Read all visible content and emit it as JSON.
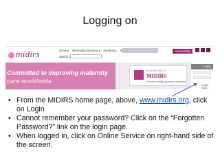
{
  "slide": {
    "title": "Logging on"
  },
  "website": {
    "logo": "midirs",
    "nav_items": [
      "Home ▸",
      "Information Services ▸",
      "Students ▸",
      "Shop",
      "Informed Choice ▸"
    ],
    "search_label": "Search the site:",
    "accessibility": "Accessibility",
    "banner_line1": "Committed to improving maternity",
    "banner_line2": "care worldwide",
    "essentially_label": "ESSENTIALLY",
    "essentially_name": "MIDIRS",
    "essentially_sub": "The new monthly journal for midwives",
    "login_header": "Login",
    "login_link": "Login, sign..."
  },
  "bullets": [
    {
      "pre": "From the MIDIRS home page, above, ",
      "link": "www.midirs.org",
      "post": ", click on Login"
    },
    {
      "pre": "Cannot remember your password? Click on the “Forgotten Password?” link on the login page.",
      "link": "",
      "post": ""
    },
    {
      "pre": "When logged in, click on Online Service on right-hand side of the screen.",
      "link": "",
      "post": ""
    }
  ],
  "colors": {
    "brand": "#9b1f6d",
    "banner": "#d67fb0",
    "link": "#0645ad",
    "arrow": "#4a7bb0"
  }
}
